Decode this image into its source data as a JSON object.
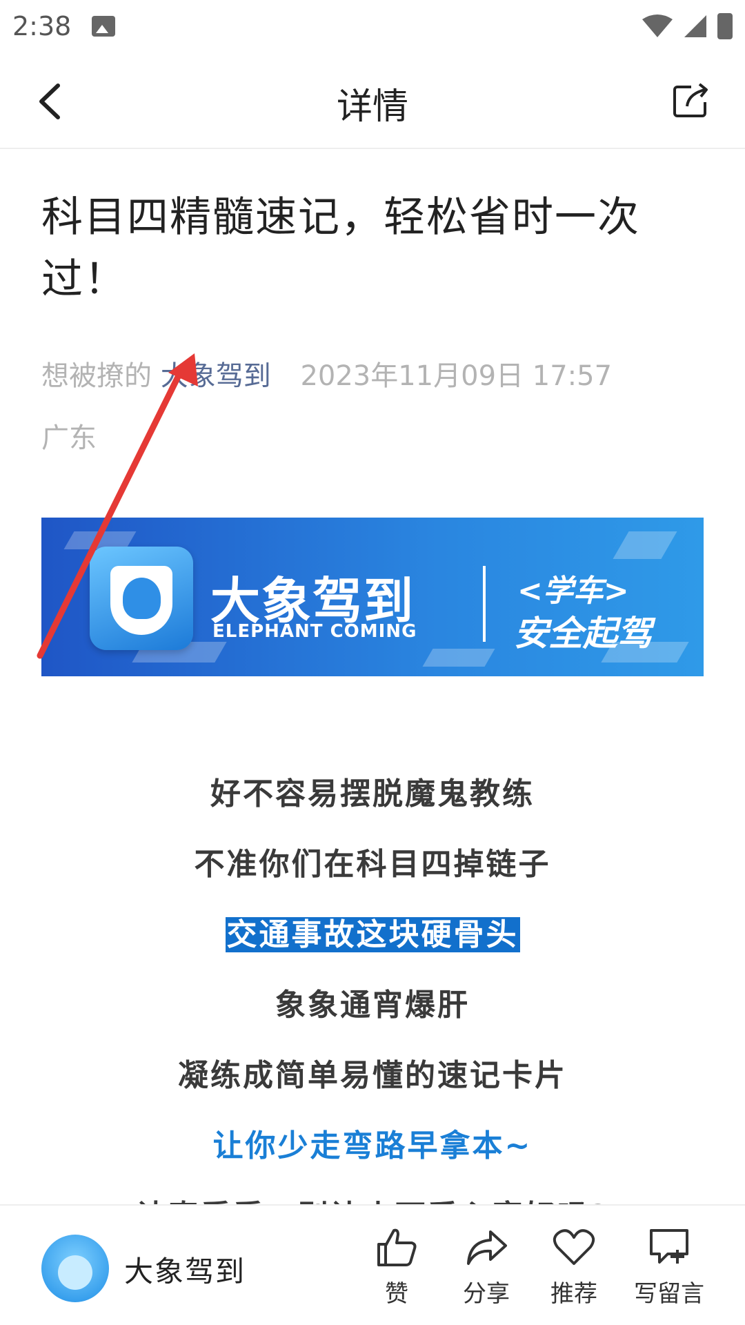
{
  "status_bar": {
    "time": "2:38"
  },
  "header": {
    "title": "详情"
  },
  "article": {
    "title": "科目四精髓速记，轻松省时一次过！",
    "author": "想被撩的",
    "account": "大象驾到",
    "date": "2023年11月09日 17:57",
    "location": "广东"
  },
  "banner": {
    "brand": "大象驾到",
    "brand_en": "ELEPHANT COMING",
    "tag1": "<学车>",
    "tag2": "安全起驾"
  },
  "paragraphs": [
    "好不容易摆脱魔鬼教练",
    "不准你们在科目四掉链子",
    "交通事故这块硬骨头",
    "象象通宵爆肝",
    "凝练成简单易懂的速记卡片",
    "让你少走弯路早拿本~",
    "认真看看，别让小可爱心塞好吗?"
  ],
  "bottom_bar": {
    "account_name": "大象驾到",
    "actions": {
      "like": "赞",
      "share": "分享",
      "recommend": "推荐",
      "comment": "写留言"
    }
  },
  "colors": {
    "accent_blue": "#1a7fd6",
    "highlight": "#1270cc",
    "account_link": "#576b95",
    "annotation_arrow": "#e53935"
  }
}
